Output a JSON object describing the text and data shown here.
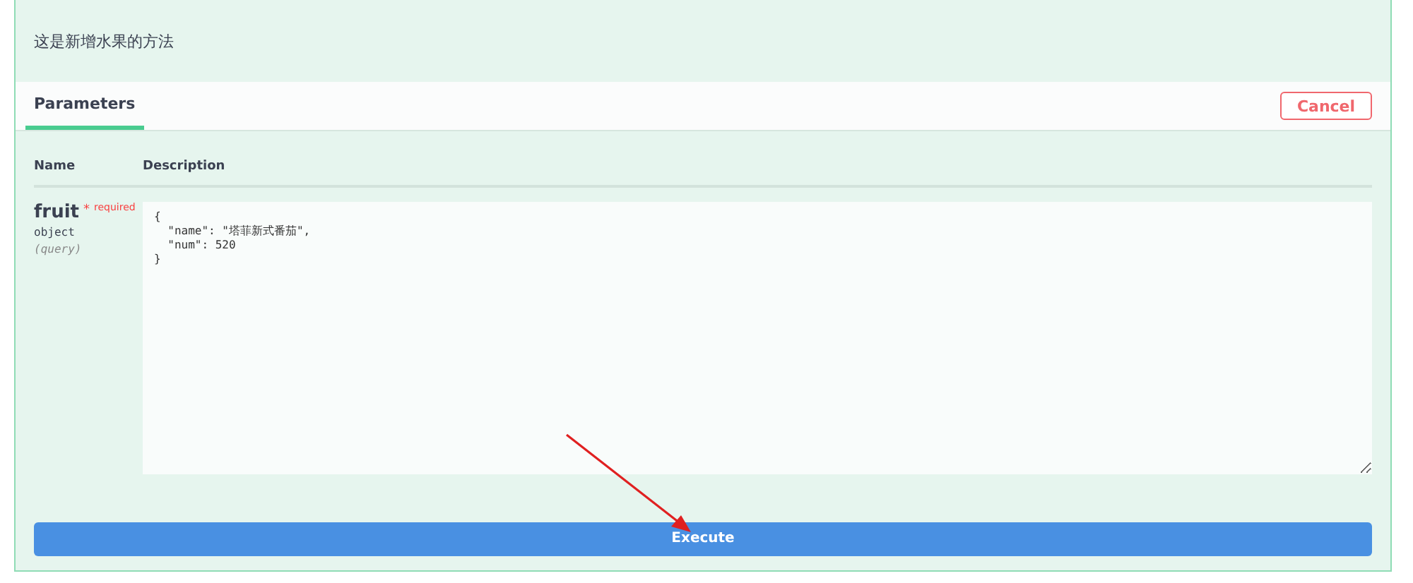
{
  "description": "这是新增水果的方法",
  "tabs": [
    {
      "label": "Parameters",
      "selected": true
    }
  ],
  "cancel_button": "Cancel",
  "table": {
    "columns": [
      "Name",
      "Description"
    ],
    "rows": [
      {
        "name": "fruit",
        "required_mark": "*",
        "required_label": "required",
        "type": "object",
        "location": "(query)",
        "value": "{\n  \"name\": \"塔菲新式番茄\",\n  \"num\": 520\n}"
      }
    ]
  },
  "execute_button": "Execute"
}
